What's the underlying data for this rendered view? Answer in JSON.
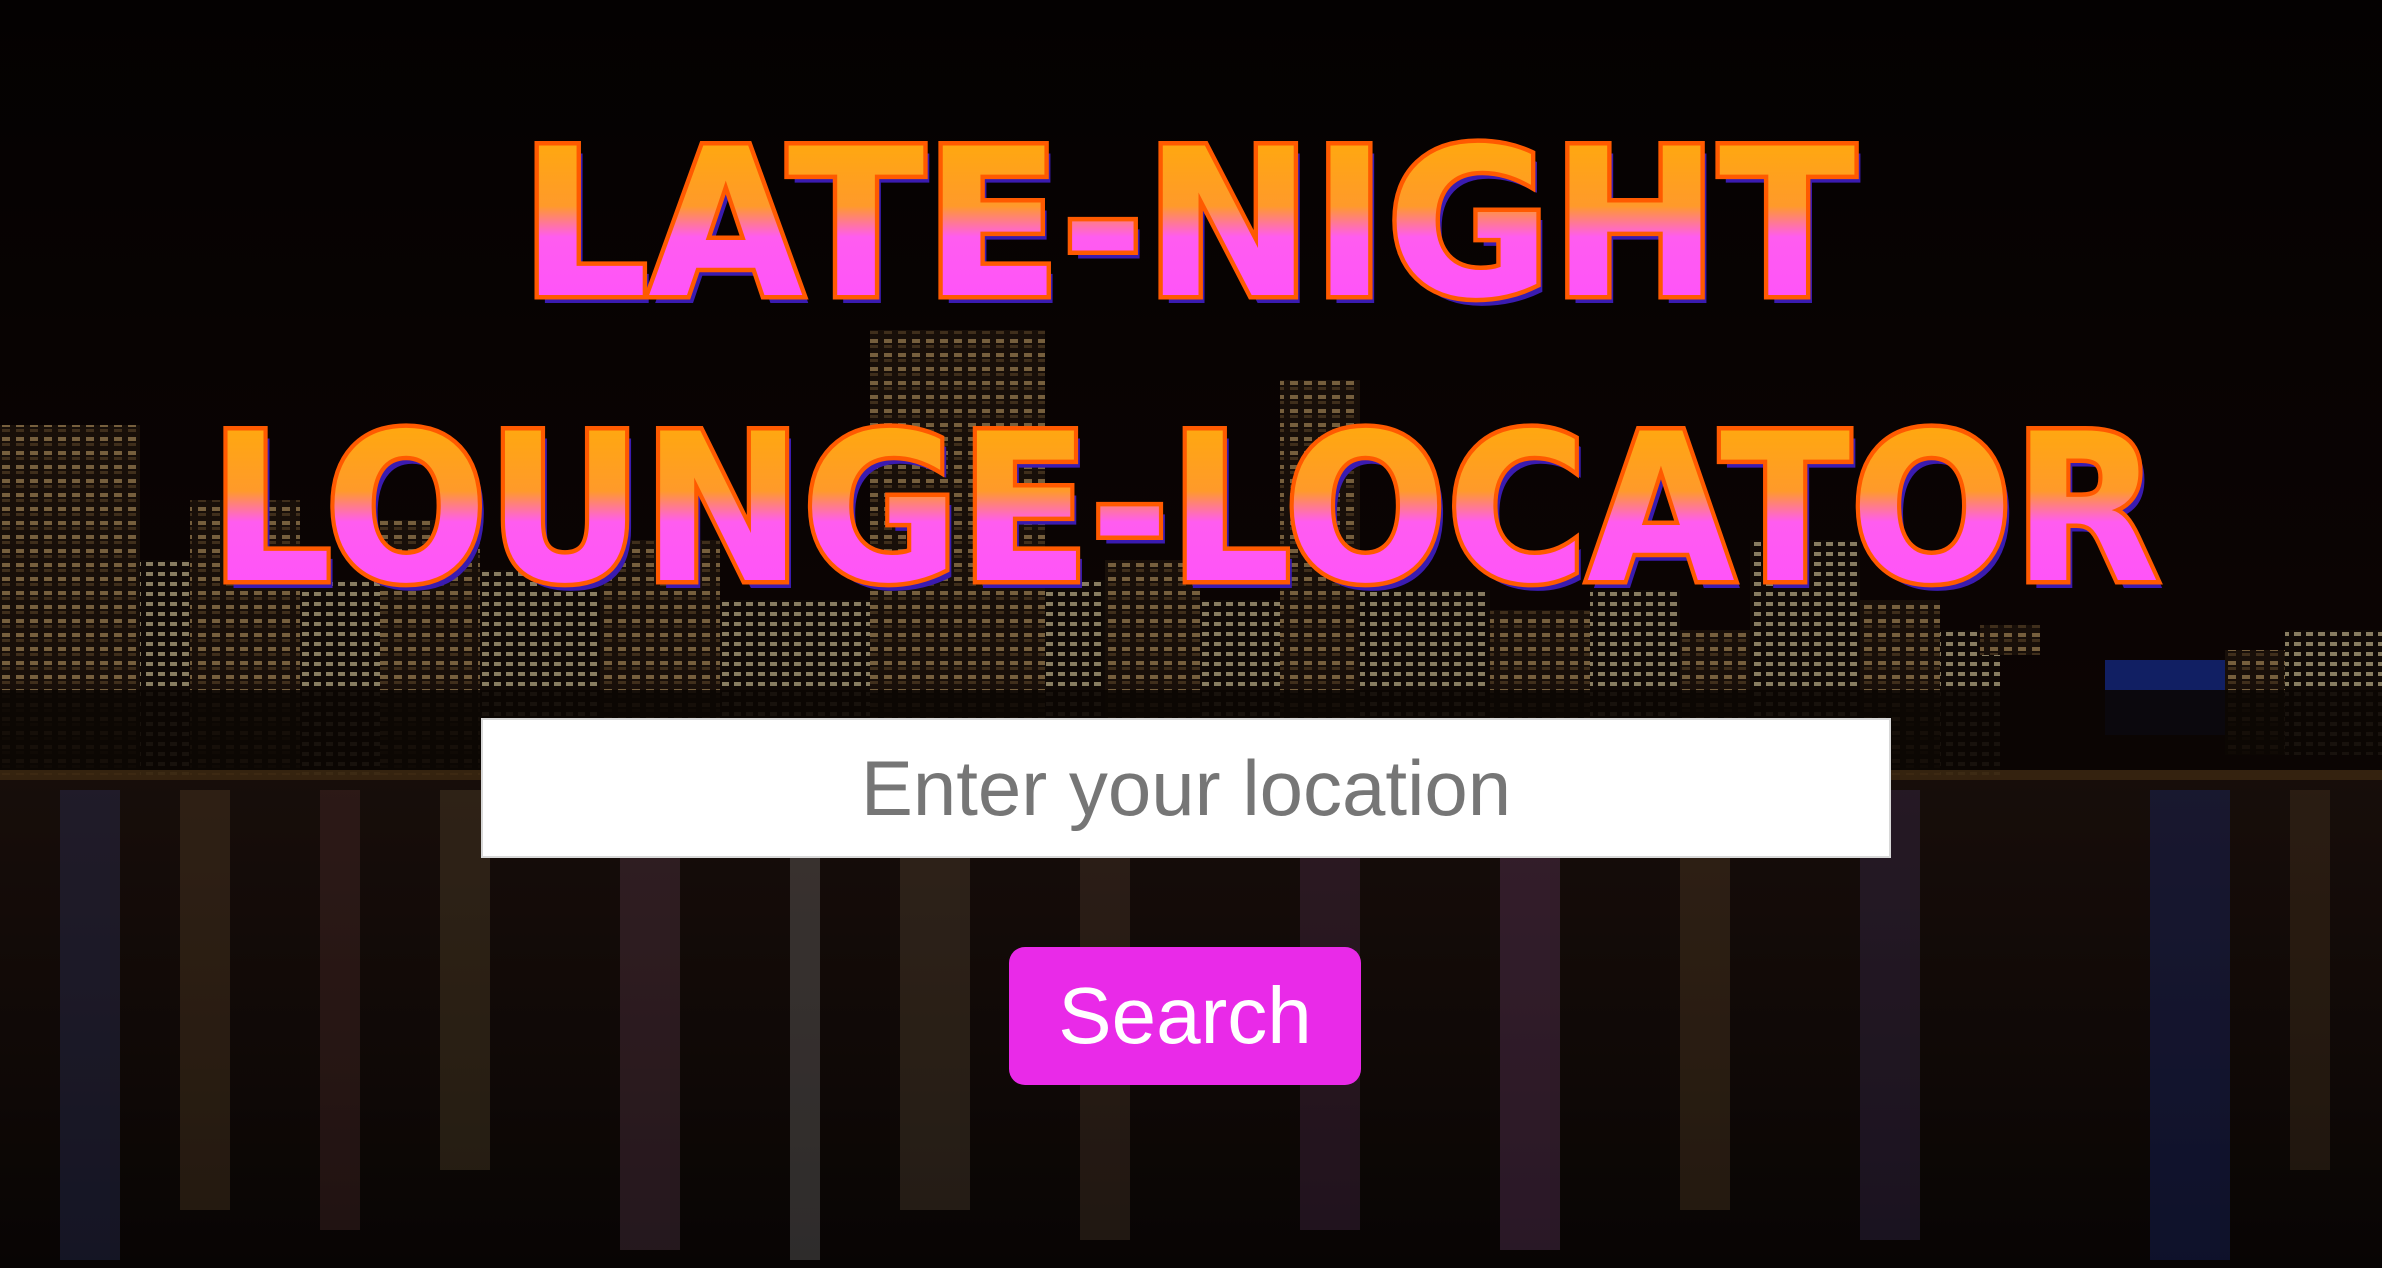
{
  "title": {
    "line1": "LATE-NIGHT",
    "line2": "LOUNGE-LOCATOR"
  },
  "search": {
    "placeholder": "Enter your location",
    "value": ""
  },
  "search_button": {
    "label": "Search"
  },
  "colors": {
    "background": "#0a0505",
    "title_top": "#ffb000",
    "title_bottom": "#ff4dff",
    "title_outline": "#ff5a00",
    "title_shadow": "#3a1bb0",
    "button": "#e92ae8",
    "input_bg": "#ffffff",
    "placeholder": "#767676"
  },
  "background_image": {
    "icon": "night-city-skyline-over-water"
  }
}
